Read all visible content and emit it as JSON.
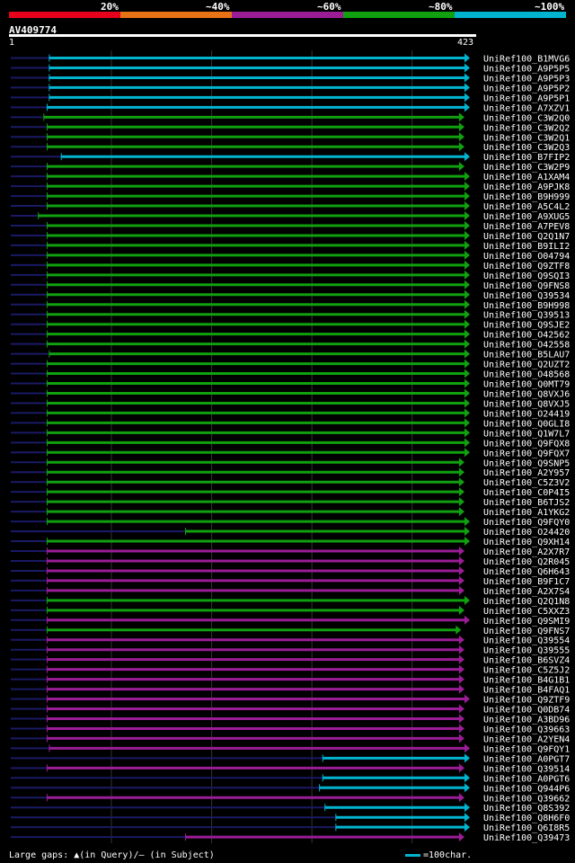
{
  "legend": {
    "segments": [
      {
        "label": "20%",
        "color": "#e6001c"
      },
      {
        "label": "~40%",
        "color": "#e87314"
      },
      {
        "label": "~60%",
        "color": "#9a1d96"
      },
      {
        "label": "~80%",
        "color": "#10a010"
      },
      {
        "label": "~100%",
        "color": "#00b4d0"
      }
    ]
  },
  "query": {
    "name": "AV409774",
    "start_label": "1",
    "end_label": "423",
    "length": 423
  },
  "footer": {
    "gaps_text": "Large gaps: ▲(in Query)/– (in Subject)",
    "scale_text": "=100char."
  },
  "chart_data": {
    "type": "alignment",
    "query_length": 423,
    "color_legend": [
      "20%",
      "~40%",
      "~60%",
      "~80%",
      "~100%"
    ],
    "hits": [
      {
        "name": "UniRef100_B1MVG6",
        "identity": "~100%",
        "start": 37,
        "end": 423
      },
      {
        "name": "UniRef100_A9P5P5",
        "identity": "~100%",
        "start": 37,
        "end": 423
      },
      {
        "name": "UniRef100_A9P5P3",
        "identity": "~100%",
        "start": 37,
        "end": 423
      },
      {
        "name": "UniRef100_A9P5P2",
        "identity": "~100%",
        "start": 37,
        "end": 423
      },
      {
        "name": "UniRef100_A9P5P1",
        "identity": "~100%",
        "start": 37,
        "end": 423
      },
      {
        "name": "UniRef100_A7XZV1",
        "identity": "~100%",
        "start": 35,
        "end": 423
      },
      {
        "name": "UniRef100_C3W2Q0",
        "identity": "~80%",
        "start": 32,
        "end": 418
      },
      {
        "name": "UniRef100_C3W2Q2",
        "identity": "~80%",
        "start": 35,
        "end": 418
      },
      {
        "name": "UniRef100_C3W2Q1",
        "identity": "~80%",
        "start": 35,
        "end": 418
      },
      {
        "name": "UniRef100_C3W2Q3",
        "identity": "~80%",
        "start": 35,
        "end": 418
      },
      {
        "name": "UniRef100_B7FIP2",
        "identity": "~100%",
        "start": 48,
        "end": 423
      },
      {
        "name": "UniRef100_C3W2P9",
        "identity": "~80%",
        "start": 35,
        "end": 418
      },
      {
        "name": "UniRef100_A1XAM4",
        "identity": "~80%",
        "start": 35,
        "end": 423
      },
      {
        "name": "UniRef100_A9PJK8",
        "identity": "~80%",
        "start": 35,
        "end": 423
      },
      {
        "name": "UniRef100_B9H999",
        "identity": "~80%",
        "start": 35,
        "end": 423
      },
      {
        "name": "UniRef100_A5C4L2",
        "identity": "~80%",
        "start": 35,
        "end": 423
      },
      {
        "name": "UniRef100_A9XUG5",
        "identity": "~80%",
        "start": 27,
        "end": 423
      },
      {
        "name": "UniRef100_A7PEV8",
        "identity": "~80%",
        "start": 35,
        "end": 423
      },
      {
        "name": "UniRef100_Q2Q1N7",
        "identity": "~80%",
        "start": 35,
        "end": 423
      },
      {
        "name": "UniRef100_B9ILI2",
        "identity": "~80%",
        "start": 35,
        "end": 423
      },
      {
        "name": "UniRef100_O04794",
        "identity": "~80%",
        "start": 35,
        "end": 423
      },
      {
        "name": "UniRef100_Q9ZTF8",
        "identity": "~80%",
        "start": 35,
        "end": 423
      },
      {
        "name": "UniRef100_Q9SQI3",
        "identity": "~80%",
        "start": 35,
        "end": 423
      },
      {
        "name": "UniRef100_Q9FNS8",
        "identity": "~80%",
        "start": 35,
        "end": 423
      },
      {
        "name": "UniRef100_Q39534",
        "identity": "~80%",
        "start": 35,
        "end": 423
      },
      {
        "name": "UniRef100_B9H998",
        "identity": "~80%",
        "start": 35,
        "end": 423
      },
      {
        "name": "UniRef100_Q39513",
        "identity": "~80%",
        "start": 35,
        "end": 423
      },
      {
        "name": "UniRef100_Q9SJE2",
        "identity": "~80%",
        "start": 35,
        "end": 423
      },
      {
        "name": "UniRef100_O42562",
        "identity": "~80%",
        "start": 35,
        "end": 423
      },
      {
        "name": "UniRef100_O42558",
        "identity": "~80%",
        "start": 35,
        "end": 423
      },
      {
        "name": "UniRef100_B5LAU7",
        "identity": "~80%",
        "start": 37,
        "end": 423
      },
      {
        "name": "UniRef100_Q2UZT2",
        "identity": "~80%",
        "start": 35,
        "end": 423
      },
      {
        "name": "UniRef100_O48568",
        "identity": "~80%",
        "start": 35,
        "end": 423
      },
      {
        "name": "UniRef100_Q0MT79",
        "identity": "~80%",
        "start": 35,
        "end": 423
      },
      {
        "name": "UniRef100_Q8VXJ6",
        "identity": "~80%",
        "start": 35,
        "end": 423
      },
      {
        "name": "UniRef100_Q8VXJ5",
        "identity": "~80%",
        "start": 35,
        "end": 423
      },
      {
        "name": "UniRef100_O24419",
        "identity": "~80%",
        "start": 35,
        "end": 423
      },
      {
        "name": "UniRef100_Q0GLI8",
        "identity": "~80%",
        "start": 35,
        "end": 423
      },
      {
        "name": "UniRef100_Q1W7L7",
        "identity": "~80%",
        "start": 35,
        "end": 423
      },
      {
        "name": "UniRef100_Q9FQX8",
        "identity": "~80%",
        "start": 35,
        "end": 423
      },
      {
        "name": "UniRef100_Q9FQX7",
        "identity": "~80%",
        "start": 35,
        "end": 423
      },
      {
        "name": "UniRef100_Q9SNP5",
        "identity": "~80%",
        "start": 35,
        "end": 418
      },
      {
        "name": "UniRef100_A2Y957",
        "identity": "~80%",
        "start": 35,
        "end": 418
      },
      {
        "name": "UniRef100_C5Z3V2",
        "identity": "~80%",
        "start": 35,
        "end": 418
      },
      {
        "name": "UniRef100_C0P4I5",
        "identity": "~80%",
        "start": 35,
        "end": 418
      },
      {
        "name": "UniRef100_B6TJS2",
        "identity": "~80%",
        "start": 35,
        "end": 418
      },
      {
        "name": "UniRef100_A1YKG2",
        "identity": "~80%",
        "start": 35,
        "end": 418
      },
      {
        "name": "UniRef100_Q9FQY0",
        "identity": "~80%",
        "start": 35,
        "end": 423
      },
      {
        "name": "UniRef100_O24420",
        "identity": "~80%",
        "start": 162,
        "end": 423
      },
      {
        "name": "UniRef100_Q9XH14",
        "identity": "~80%",
        "start": 35,
        "end": 423
      },
      {
        "name": "UniRef100_A2X7R7",
        "identity": "~60%",
        "start": 35,
        "end": 418
      },
      {
        "name": "UniRef100_Q2R045",
        "identity": "~60%",
        "start": 35,
        "end": 418
      },
      {
        "name": "UniRef100_Q6H643",
        "identity": "~60%",
        "start": 35,
        "end": 418
      },
      {
        "name": "UniRef100_B9F1C7",
        "identity": "~60%",
        "start": 35,
        "end": 418
      },
      {
        "name": "UniRef100_A2X7S4",
        "identity": "~60%",
        "start": 35,
        "end": 418
      },
      {
        "name": "UniRef100_Q2Q1N8",
        "identity": "~80%",
        "start": 35,
        "end": 423
      },
      {
        "name": "UniRef100_C5XXZ3",
        "identity": "~80%",
        "start": 35,
        "end": 418
      },
      {
        "name": "UniRef100_Q9SMI9",
        "identity": "~60%",
        "start": 35,
        "end": 423
      },
      {
        "name": "UniRef100_Q9FNS7",
        "identity": "~80%",
        "start": 35,
        "end": 415
      },
      {
        "name": "UniRef100_Q39554",
        "identity": "~60%",
        "start": 35,
        "end": 418
      },
      {
        "name": "UniRef100_Q39555",
        "identity": "~60%",
        "start": 35,
        "end": 418
      },
      {
        "name": "UniRef100_B6SVZ4",
        "identity": "~60%",
        "start": 35,
        "end": 418
      },
      {
        "name": "UniRef100_C5Z5J2",
        "identity": "~60%",
        "start": 35,
        "end": 418
      },
      {
        "name": "UniRef100_B4G1B1",
        "identity": "~60%",
        "start": 35,
        "end": 418
      },
      {
        "name": "UniRef100_B4FAQ1",
        "identity": "~60%",
        "start": 35,
        "end": 418
      },
      {
        "name": "UniRef100_Q9ZTF9",
        "identity": "~60%",
        "start": 35,
        "end": 423
      },
      {
        "name": "UniRef100_Q0DB74",
        "identity": "~60%",
        "start": 35,
        "end": 418
      },
      {
        "name": "UniRef100_A3BD96",
        "identity": "~60%",
        "start": 35,
        "end": 418
      },
      {
        "name": "UniRef100_Q39663",
        "identity": "~60%",
        "start": 35,
        "end": 418
      },
      {
        "name": "UniRef100_A2YEN4",
        "identity": "~60%",
        "start": 35,
        "end": 418
      },
      {
        "name": "UniRef100_Q9FQY1",
        "identity": "~60%",
        "start": 37,
        "end": 423
      },
      {
        "name": "UniRef100_A0PGT7",
        "identity": "~100%",
        "start": 288,
        "end": 423
      },
      {
        "name": "UniRef100_Q39514",
        "identity": "~60%",
        "start": 35,
        "end": 418
      },
      {
        "name": "UniRef100_A0PGT6",
        "identity": "~100%",
        "start": 288,
        "end": 423
      },
      {
        "name": "UniRef100_Q944P6",
        "identity": "~100%",
        "start": 285,
        "end": 423
      },
      {
        "name": "UniRef100_Q39662",
        "identity": "~60%",
        "start": 35,
        "end": 418
      },
      {
        "name": "UniRef100_Q8S392",
        "identity": "~100%",
        "start": 290,
        "end": 423
      },
      {
        "name": "UniRef100_Q8H6F0",
        "identity": "~100%",
        "start": 300,
        "end": 423
      },
      {
        "name": "UniRef100_Q6I8R5",
        "identity": "~100%",
        "start": 300,
        "end": 423
      },
      {
        "name": "UniRef100_Q39473",
        "identity": "~60%",
        "start": 162,
        "end": 418
      }
    ]
  }
}
